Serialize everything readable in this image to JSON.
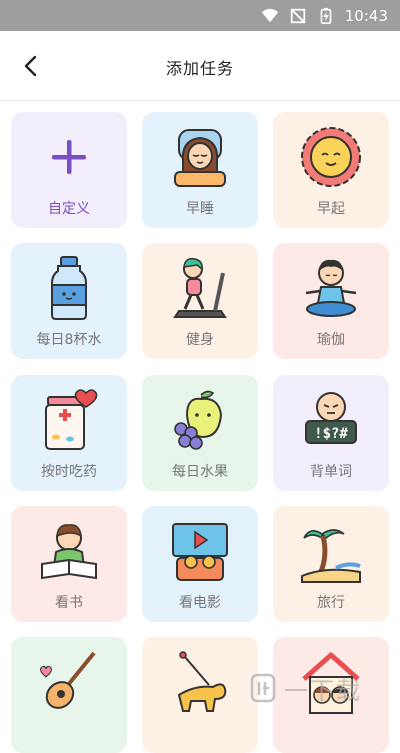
{
  "status_bar": {
    "time": "10:43"
  },
  "header": {
    "title": "添加任务"
  },
  "tasks": [
    {
      "label": "自定义",
      "icon": "plus-icon"
    },
    {
      "label": "早睡",
      "icon": "sleeping-girl-icon"
    },
    {
      "label": "早起",
      "icon": "sun-icon"
    },
    {
      "label": "每日8杯水",
      "icon": "water-bottle-icon"
    },
    {
      "label": "健身",
      "icon": "treadmill-icon"
    },
    {
      "label": "瑜伽",
      "icon": "yoga-icon"
    },
    {
      "label": "按时吃药",
      "icon": "medicine-bottle-icon"
    },
    {
      "label": "每日水果",
      "icon": "fruit-icon"
    },
    {
      "label": "背单词",
      "icon": "words-icon"
    },
    {
      "label": "看书",
      "icon": "reading-boy-icon"
    },
    {
      "label": "看电影",
      "icon": "movie-icon"
    },
    {
      "label": "旅行",
      "icon": "palm-beach-icon"
    },
    {
      "label": "",
      "icon": "guitar-icon"
    },
    {
      "label": "",
      "icon": "walk-dog-icon"
    },
    {
      "label": "",
      "icon": "family-house-icon"
    }
  ],
  "watermark": {
    "text": "一下载"
  },
  "colors": {
    "accent": "#7a4fc4",
    "status_bar": "#9e9e9e"
  }
}
